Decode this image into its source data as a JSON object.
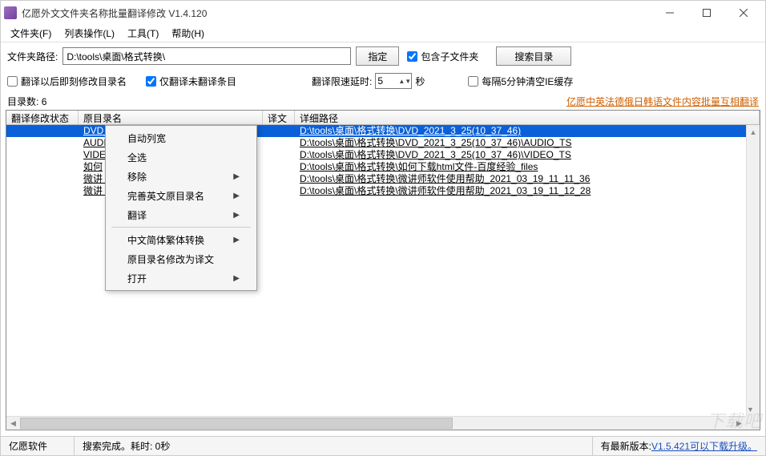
{
  "window": {
    "title": "亿愿外文文件夹名称批量翻译修改 V1.4.120"
  },
  "menus": {
    "file": "文件夹(F)",
    "list": "列表操作(L)",
    "tools": "工具(T)",
    "help": "帮助(H)"
  },
  "toolbar": {
    "path_label": "文件夹路径:",
    "path_value": "D:\\tools\\桌面\\格式转换\\",
    "set_btn": "指定",
    "include_sub": "包含子文件夹",
    "search_btn": "搜索目录"
  },
  "options": {
    "modify_after": "翻译以后即刻修改目录名",
    "only_untranslated": "仅翻译未翻译条目",
    "delay_label": "翻译限速延时:",
    "delay_value": "5",
    "delay_unit": "秒",
    "clear_ie": "每隔5分钟清空IE缓存"
  },
  "counts": {
    "label": "目录数:",
    "value": "6"
  },
  "promo_link": "亿愿中英法德俄日韩语文件内容批量互相翻译",
  "columns": {
    "c0": "翻译修改状态",
    "c1": "原目录名",
    "c2": "译文",
    "c3": "详细路径"
  },
  "rows": [
    {
      "name": "DVD_2021_3_25(10_37_46)",
      "path": "D:\\tools\\桌面\\格式转换\\DVD_2021_3_25(10_37_46)",
      "sel": true
    },
    {
      "name": "AUDI",
      "path": "D:\\tools\\桌面\\格式转换\\DVD_2021_3_25(10_37_46)\\AUDIO_TS"
    },
    {
      "name": "VIDE",
      "path": "D:\\tools\\桌面\\格式转换\\DVD_2021_3_25(10_37_46)\\VIDEO_TS"
    },
    {
      "name": "如何",
      "path": "D:\\tools\\桌面\\格式转换\\如何下载html文件-百度经验_files"
    },
    {
      "name": "微讲                                      6",
      "path": "D:\\tools\\桌面\\格式转换\\微讲师软件使用帮助_2021_03_19_11_11_36"
    },
    {
      "name": "微讲                                      8",
      "path": "D:\\tools\\桌面\\格式转换\\微讲师软件使用帮助_2021_03_19_11_12_28"
    }
  ],
  "context_menu": [
    {
      "label": "自动列宽"
    },
    {
      "label": "全选"
    },
    {
      "label": "移除",
      "sub": true
    },
    {
      "label": "完善英文原目录名",
      "sub": true
    },
    {
      "label": "翻译",
      "sub": true
    },
    {
      "sep": true
    },
    {
      "label": "中文简体繁体转换",
      "sub": true
    },
    {
      "label": "原目录名修改为译文"
    },
    {
      "label": "打开",
      "sub": true
    }
  ],
  "status": {
    "left": "亿愿软件",
    "mid": "搜索完成。耗时: 0秒",
    "right_prefix": "有最新版本: ",
    "right_link": "V1.5.421可以下载升级。"
  },
  "watermark": "下载吧"
}
